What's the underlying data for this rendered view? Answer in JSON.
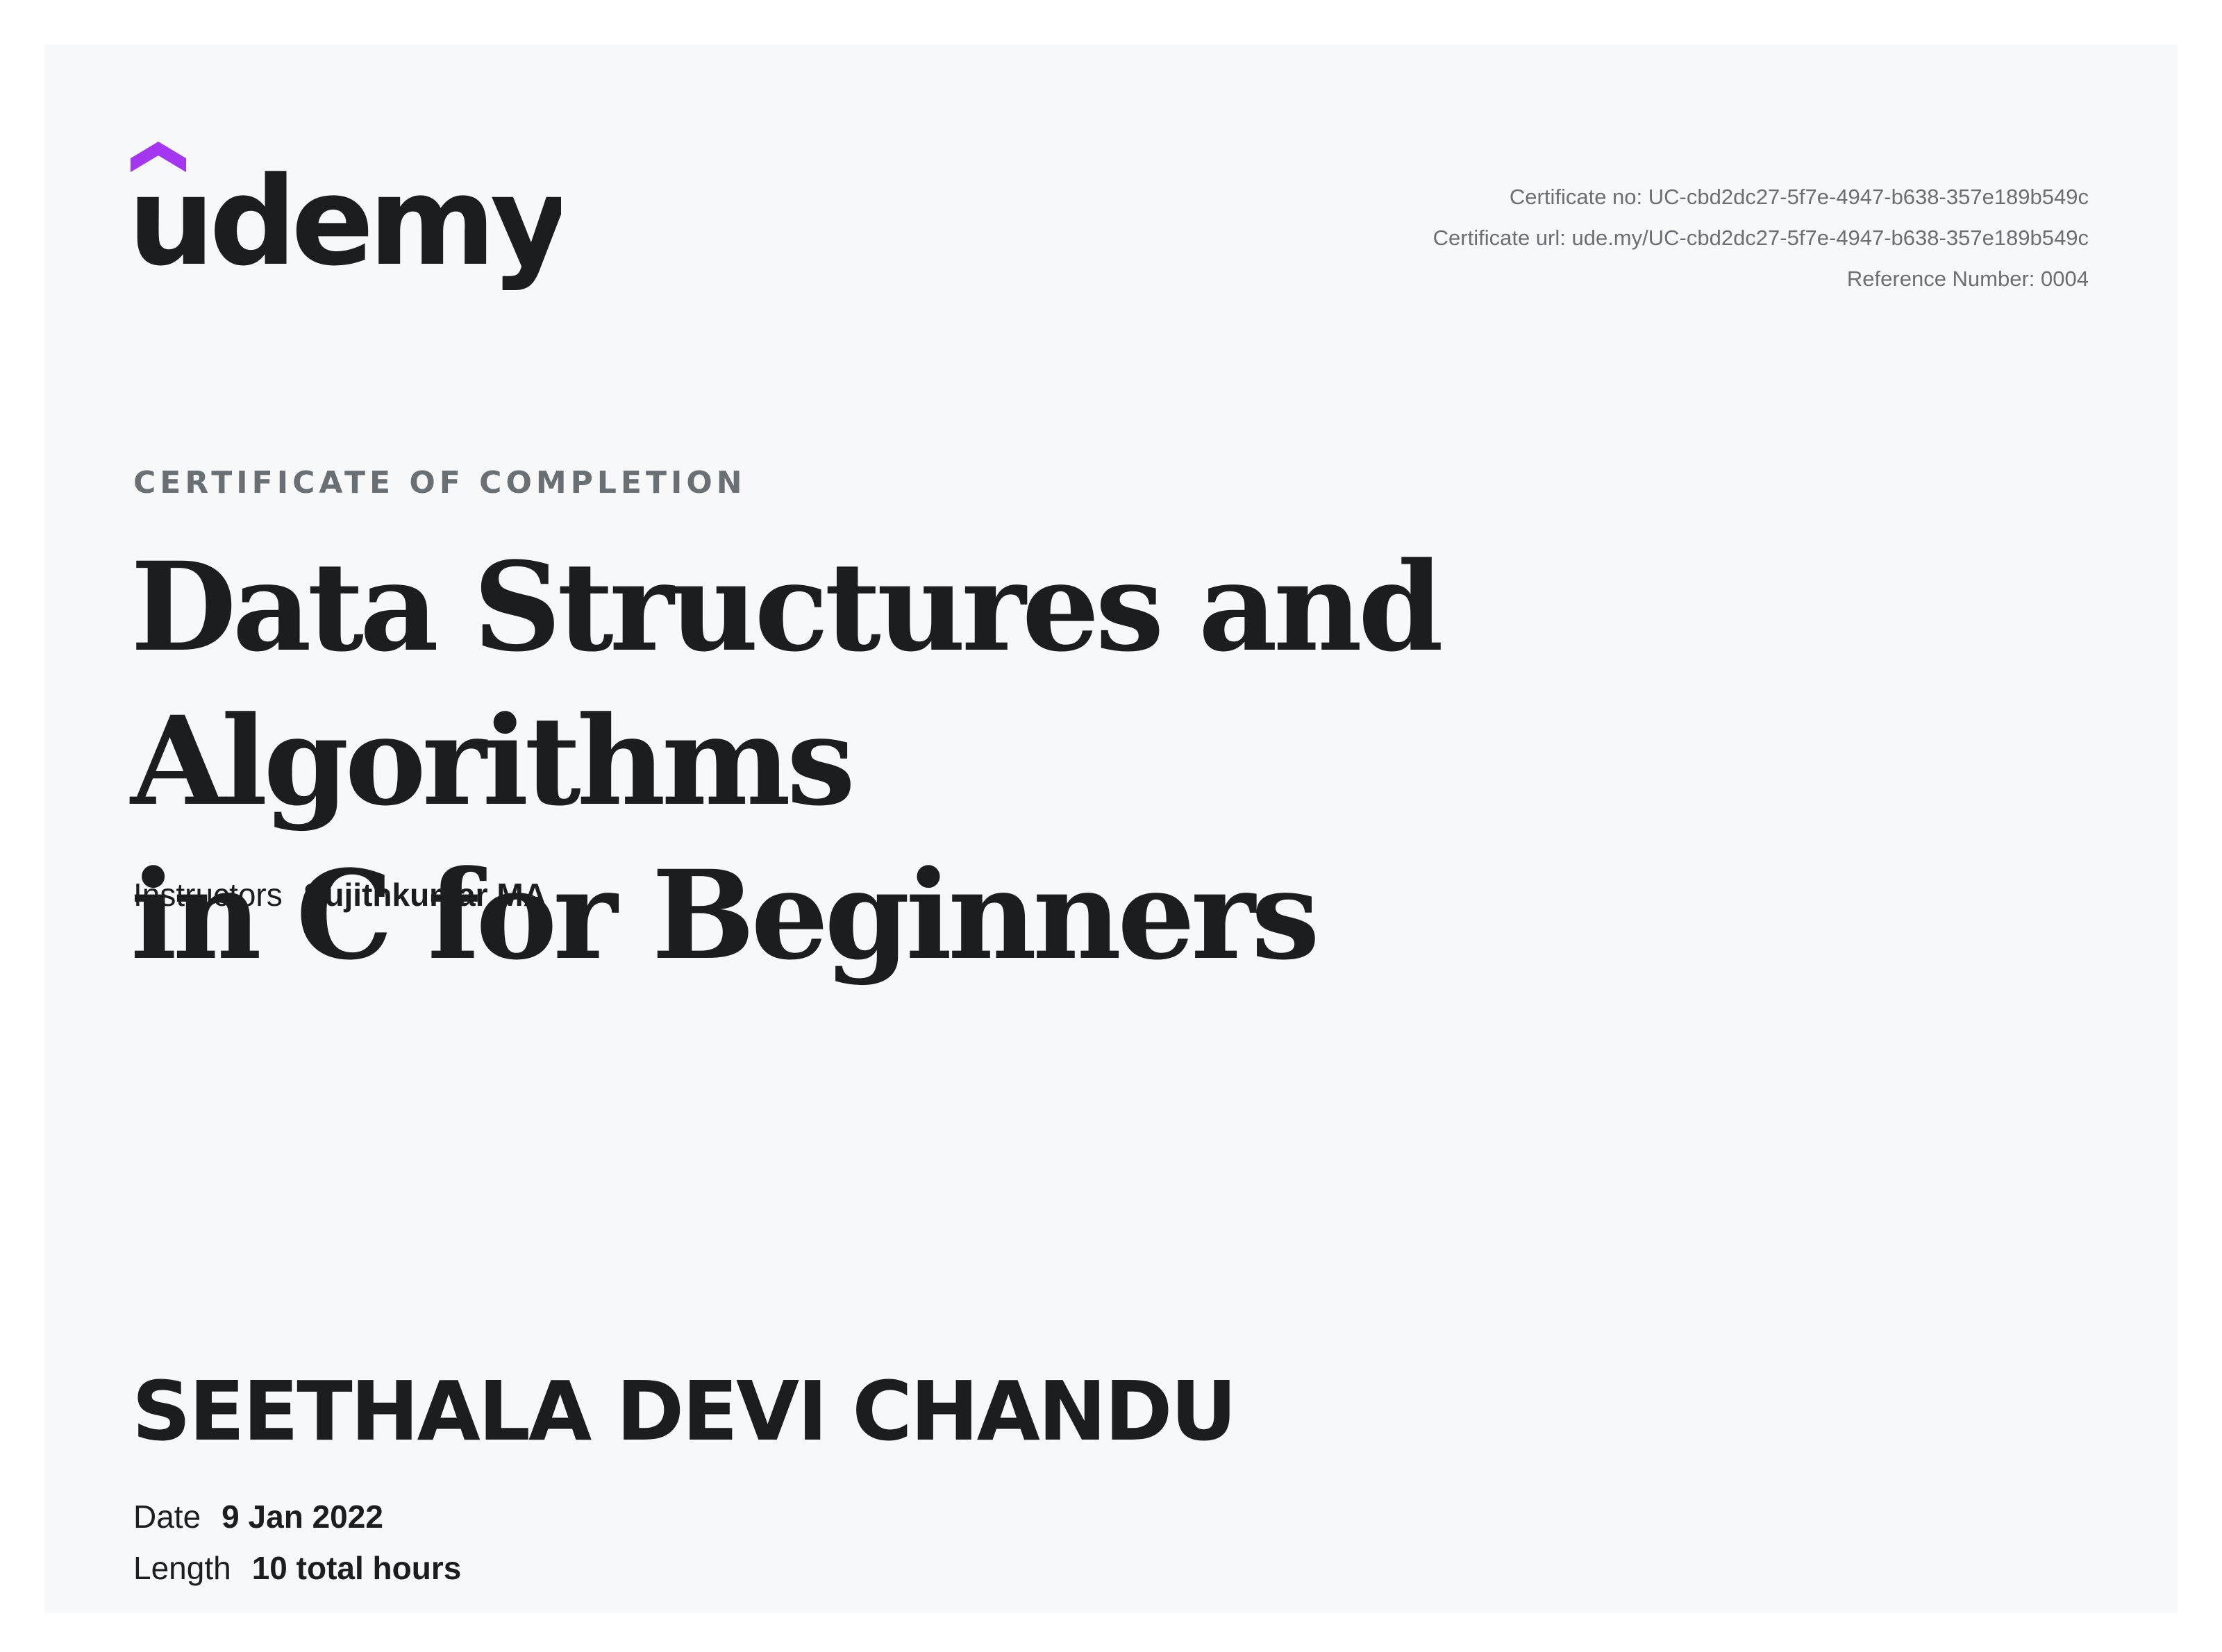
{
  "brand": {
    "logo_text": "udemy",
    "accent_color": "#a435f0",
    "text_color": "#1c1d1f"
  },
  "meta": {
    "certificate_no": "Certificate no: UC-cbd2dc27-5f7e-4947-b638-357e189b549c",
    "certificate_url": "Certificate url: ude.my/UC-cbd2dc27-5f7e-4947-b638-357e189b549c",
    "reference_number": "Reference Number: 0004"
  },
  "certificate": {
    "label": "CERTIFICATE OF COMPLETION",
    "course_title_line1": "Data Structures and Algorithms",
    "course_title_line2": "in C for Beginners",
    "instructors_label": "Instructors",
    "instructors_value": "Sujithkumar MA",
    "student_name": "SEETHALA DEVI CHANDU",
    "date_label": "Date",
    "date_value": "9 Jan 2022",
    "length_label": "Length",
    "length_value": "10 total hours"
  },
  "colors": {
    "page_bg": "#ffffff",
    "card_bg": "#f7f8fa",
    "muted_text": "#6a6f73"
  }
}
